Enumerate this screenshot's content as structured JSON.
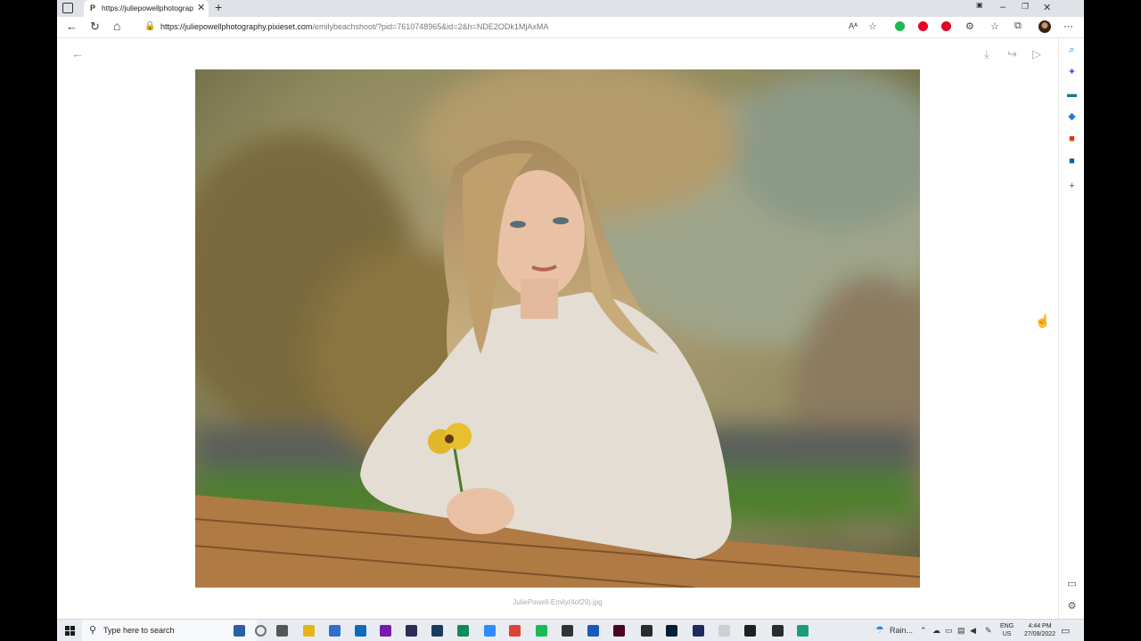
{
  "browser": {
    "tab_title": "https://juliepowellphotography.pixieset.com/emilybeachshoot/?pid=...",
    "tab_favicon": "P",
    "url_host": "https://juliepowellphotography.pixieset.com",
    "url_path": "/emilybeachshoot/?pid=7610748965&id=2&h=NDE2ODk1MjAxMA",
    "icons": {
      "tab_actions": "tab-actions-icon",
      "close": "close-icon",
      "new_tab": "plus-icon",
      "back": "arrow-left-icon",
      "refresh": "refresh-icon",
      "home": "home-icon",
      "lock": "lock-icon",
      "read_aloud": "read-aloud-icon",
      "favorite_add": "star-add-icon",
      "extensions": "puzzle-icon",
      "favorites": "favorites-icon",
      "collections": "collections-icon",
      "more": "more-icon"
    },
    "glyphs": {
      "close": "✕",
      "new_tab": "+",
      "back": "←",
      "refresh": "↻",
      "home": "⌂",
      "lock": "🔒",
      "read_aloud": "Aᴬ",
      "favorite_add": "☆",
      "extensions": "⚙",
      "favorites": "☆",
      "collections": "⧉",
      "more": "⋯",
      "minimize": "–",
      "restore": "❐",
      "window_close": "✕"
    },
    "ext_colors": [
      "#1db954",
      "#e60023",
      "#e60023"
    ]
  },
  "sidebar": {
    "items": [
      {
        "icon": "search-icon",
        "glyph": "⌕",
        "color": "#0078d4"
      },
      {
        "icon": "copilot-icon",
        "glyph": "✦",
        "color": "#7b3fe4"
      },
      {
        "icon": "briefcase-icon",
        "glyph": "▬",
        "color": "#0e7a8c"
      },
      {
        "icon": "games-icon",
        "glyph": "◆",
        "color": "#2a7bd4"
      },
      {
        "icon": "office-icon",
        "glyph": "■",
        "color": "#d83b01"
      },
      {
        "icon": "outlook-icon",
        "glyph": "■",
        "color": "#0364b8"
      },
      {
        "icon": "add-icon",
        "glyph": "+",
        "color": "#555555"
      }
    ],
    "bottom": [
      {
        "icon": "sidebar-toggle-icon",
        "glyph": "▭"
      },
      {
        "icon": "settings-icon",
        "glyph": "⚙"
      }
    ]
  },
  "viewer": {
    "glyphs": {
      "back": "←",
      "download": "⤓",
      "share": "↪",
      "slideshow": "▷",
      "cursor": "☝"
    },
    "filename": "JuliePowell-Emily(4of29).jpg"
  },
  "taskbar": {
    "search_placeholder": "Type here to search",
    "search_glyph": "⚲",
    "weather": "Rain...",
    "lang_line1": "ENG",
    "lang_line2": "US",
    "time": "4:44 PM",
    "date": "27/09/2022",
    "notif_glyph": "▭",
    "app_colors": [
      "#2b5fa8",
      "#707070",
      "#555555",
      "#e7b416",
      "#2f6fc9",
      "#0f6cbd",
      "#7719aa",
      "#2c2c54",
      "#1a3b5d",
      "#0c8c5a",
      "#2d8cff",
      "#db4437",
      "#1db954",
      "#333333",
      "#185abd",
      "#49021f",
      "#2b2b2b",
      "#001e36",
      "#1f2a60",
      "#cfcfcf",
      "#1f1f1f",
      "#2b2b2b",
      "#1a9e7a"
    ]
  }
}
